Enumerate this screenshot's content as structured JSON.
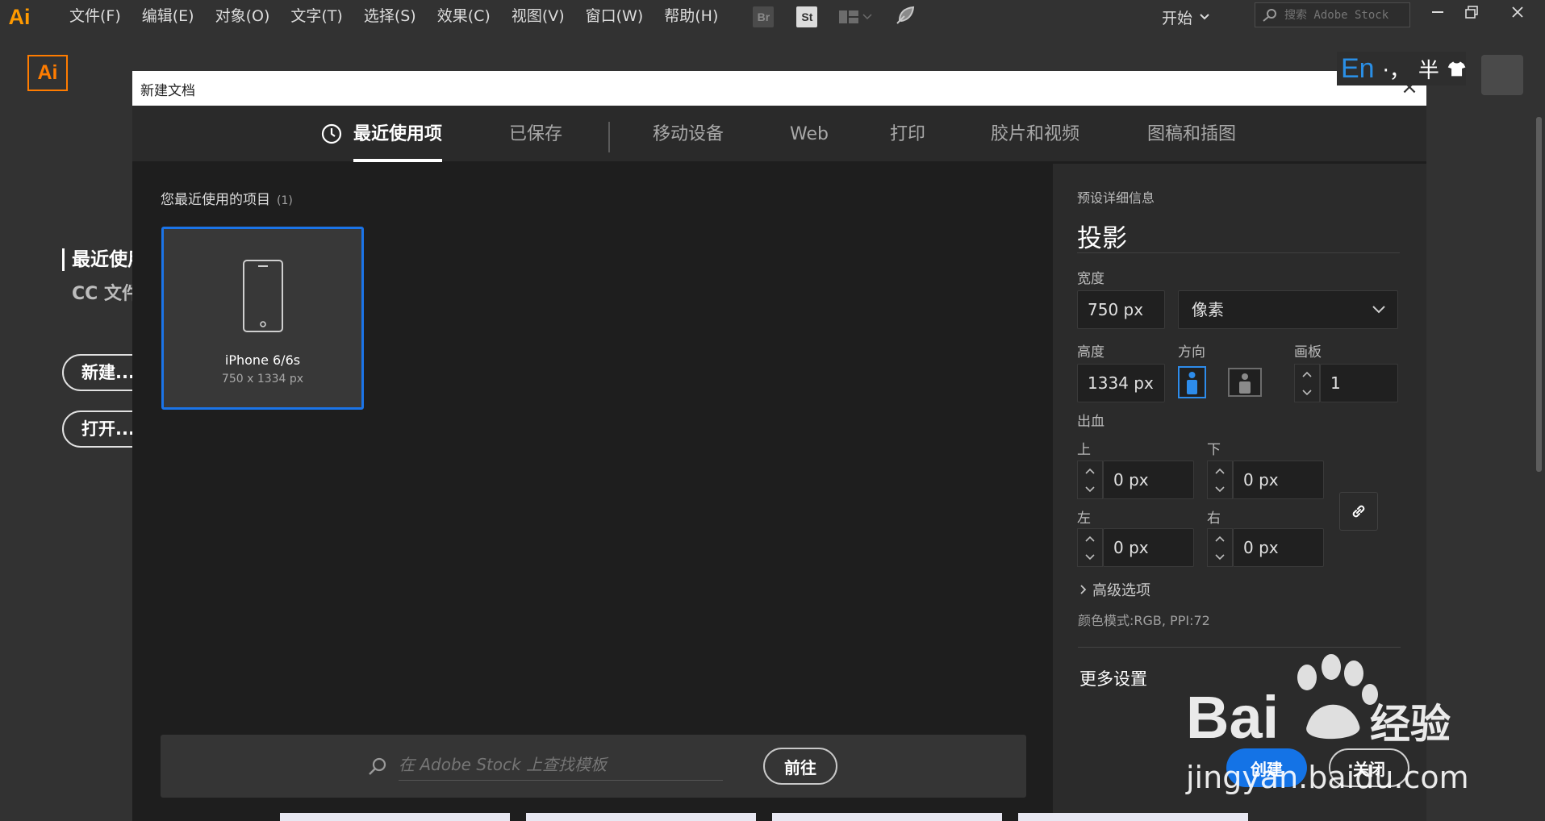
{
  "menubar": {
    "logo": "Ai",
    "items": [
      "文件(F)",
      "编辑(E)",
      "对象(O)",
      "文字(T)",
      "选择(S)",
      "效果(C)",
      "视图(V)",
      "窗口(W)",
      "帮助(H)"
    ],
    "bridge_icon": "Br",
    "stock_icon": "St",
    "workspace": "开始",
    "search_placeholder": "搜索 Adobe Stock"
  },
  "home": {
    "logo": "Ai",
    "recent_heading": "最近使用",
    "cc_files": "CC 文件",
    "new_button": "新建...",
    "open_button": "打开..."
  },
  "ime": {
    "lang": "En",
    "punct": "·，",
    "width": "半"
  },
  "dialog": {
    "title": "新建文档",
    "tabs": [
      {
        "label": "最近使用项",
        "active": true
      },
      {
        "label": "已保存",
        "active": false
      },
      {
        "label": "移动设备",
        "active": false
      },
      {
        "label": "Web",
        "active": false
      },
      {
        "label": "打印",
        "active": false
      },
      {
        "label": "胶片和视频",
        "active": false
      },
      {
        "label": "图稿和插图",
        "active": false
      }
    ],
    "recent": {
      "heading": "您最近使用的项目",
      "count": "(1)",
      "items": [
        {
          "name": "iPhone 6/6s",
          "size": "750 x 1334 px"
        }
      ]
    },
    "template_search": {
      "placeholder": "在 Adobe Stock 上查找模板",
      "go_label": "前往"
    },
    "details": {
      "section_label": "预设详细信息",
      "preset_name": "投影",
      "width_label": "宽度",
      "width_value": "750 px",
      "unit": "像素",
      "height_label": "高度",
      "height_value": "1334 px",
      "orientation_label": "方向",
      "artboards_label": "画板",
      "artboards_value": "1",
      "bleed_label": "出血",
      "bleed_top_label": "上",
      "bleed_top": "0 px",
      "bleed_bottom_label": "下",
      "bleed_bottom": "0 px",
      "bleed_left_label": "左",
      "bleed_left": "0 px",
      "bleed_right_label": "右",
      "bleed_right": "0 px",
      "advanced_label": "高级选项",
      "color_mode": "颜色模式:RGB, PPI:72",
      "more_settings": "更多设置",
      "create_label": "创建",
      "close_label": "关闭"
    }
  },
  "watermark": {
    "brand": "Bai",
    "brand2": "经验",
    "url": "jingyan.baidu.com"
  },
  "colors": {
    "accent": "#1473e6",
    "ai_orange": "#ff7c00",
    "bg": "#1e1e1e"
  }
}
